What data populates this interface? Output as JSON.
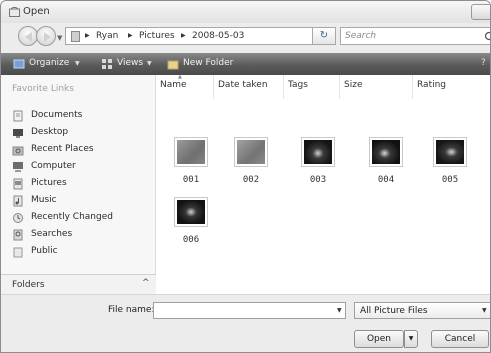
{
  "window": {
    "title": "Open"
  },
  "navigation": {
    "back_icon": "back-arrow-icon",
    "forward_icon": "forward-arrow-icon",
    "breadcrumb": [
      "Ryan",
      "Pictures",
      "2008-05-03"
    ],
    "refresh_icon": "refresh-icon"
  },
  "search": {
    "placeholder": "Search",
    "icon": "search-icon"
  },
  "toolbar": {
    "organize": "Organize",
    "views": "Views",
    "new_folder": "New Folder",
    "help_icon": "help-icon"
  },
  "sidebar": {
    "header": "Favorite Links",
    "items": [
      {
        "label": "Documents",
        "icon": "documents-icon"
      },
      {
        "label": "Desktop",
        "icon": "desktop-icon"
      },
      {
        "label": "Recent Places",
        "icon": "recent-places-icon"
      },
      {
        "label": "Computer",
        "icon": "computer-icon"
      },
      {
        "label": "Pictures",
        "icon": "pictures-icon"
      },
      {
        "label": "Music",
        "icon": "music-icon"
      },
      {
        "label": "Recently Changed",
        "icon": "recently-changed-icon"
      },
      {
        "label": "Searches",
        "icon": "searches-icon"
      },
      {
        "label": "Public",
        "icon": "public-icon"
      }
    ],
    "folders_label": "Folders",
    "folders_toggle": "^"
  },
  "file_list": {
    "columns": [
      "Name",
      "Date taken",
      "Tags",
      "Size",
      "Rating"
    ],
    "files": [
      {
        "name": "001",
        "thumb_style": "dim"
      },
      {
        "name": "002",
        "thumb_style": "dim"
      },
      {
        "name": "003",
        "thumb_style": "dark"
      },
      {
        "name": "004",
        "thumb_style": "dark"
      },
      {
        "name": "005",
        "thumb_style": "dark"
      },
      {
        "name": "006",
        "thumb_style": "dark"
      }
    ]
  },
  "footer": {
    "file_name_label": "File name:",
    "file_name_value": "",
    "filter": "All Picture Files",
    "open_label": "Open",
    "cancel_label": "Cancel"
  },
  "colors": {
    "toolbar_top": "#8a8a8a",
    "toolbar_bottom": "#4a4a4a",
    "sidebar_bg": "#f7f7f7"
  }
}
